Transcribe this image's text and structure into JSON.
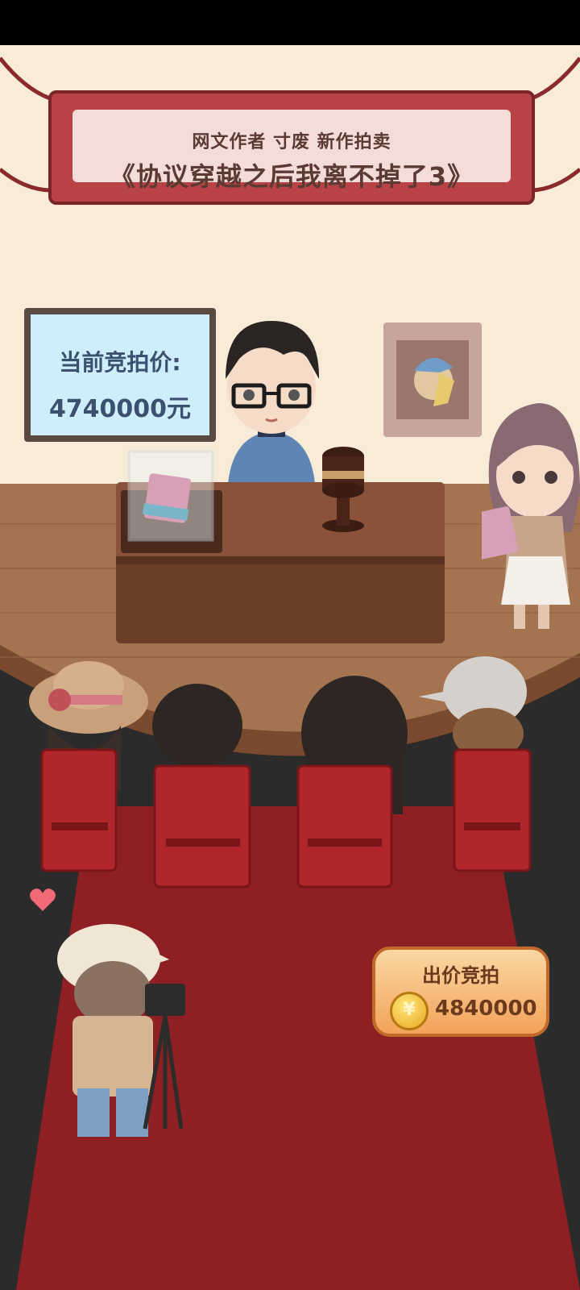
{
  "banner": {
    "subtitle": "网文作者  寸废  新作拍卖",
    "title": "《协议穿越之后我离不掉了3》"
  },
  "auction": {
    "price_label": "当前竞拍价:",
    "current_price": "4740000元"
  },
  "bid_button": {
    "label": "出价竞拍",
    "amount": "4840000",
    "coin_icon": "coin-icon"
  },
  "colors": {
    "wall": "#f8ecd8",
    "stage_wood": "#a4734f",
    "carpet": "#8e1f22",
    "floor_dark": "#2a2a2a",
    "banner_red": "#b94246",
    "price_text": "#3c5070",
    "button_orange": "#f2a35a"
  }
}
